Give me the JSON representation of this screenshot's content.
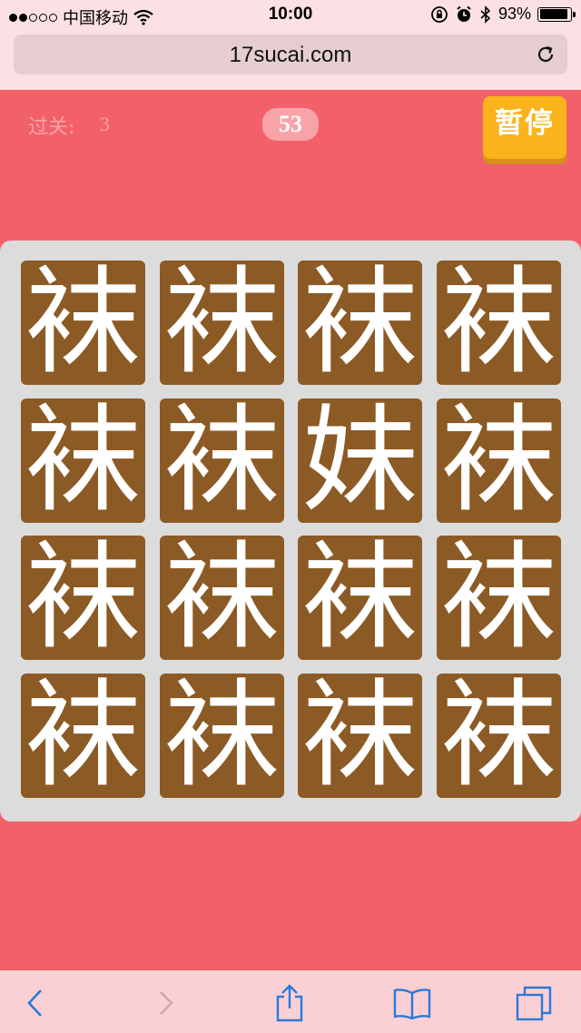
{
  "status_bar": {
    "carrier": "中国移动",
    "time": "10:00",
    "battery_percent": "93%",
    "battery_level": 0.93,
    "signal_strength": 2,
    "icons": [
      "signal-icon",
      "wifi-icon",
      "orientation-lock-icon",
      "alarm-icon",
      "bluetooth-icon",
      "battery-icon"
    ]
  },
  "browser": {
    "url": "17sucai.com",
    "toolbar_icons": [
      "back-icon",
      "forward-icon",
      "share-icon",
      "bookmarks-icon",
      "tabs-icon"
    ]
  },
  "game": {
    "level_label": "过关:",
    "level_value": "3",
    "timer": "53",
    "pause_label": "暂停",
    "tiles": [
      "袜",
      "袜",
      "袜",
      "袜",
      "袜",
      "袜",
      "妹",
      "袜",
      "袜",
      "袜",
      "袜",
      "袜",
      "袜",
      "袜",
      "袜",
      "袜"
    ]
  },
  "colors": {
    "background": "#f2616a",
    "board": "#dcdcdc",
    "tile": "#8c5a24",
    "pause_button": "#fbb31c",
    "browser_chrome": "#fbe1e3",
    "toolbar": "#fbd0d5",
    "toolbar_icon": "#2a7ad8"
  }
}
